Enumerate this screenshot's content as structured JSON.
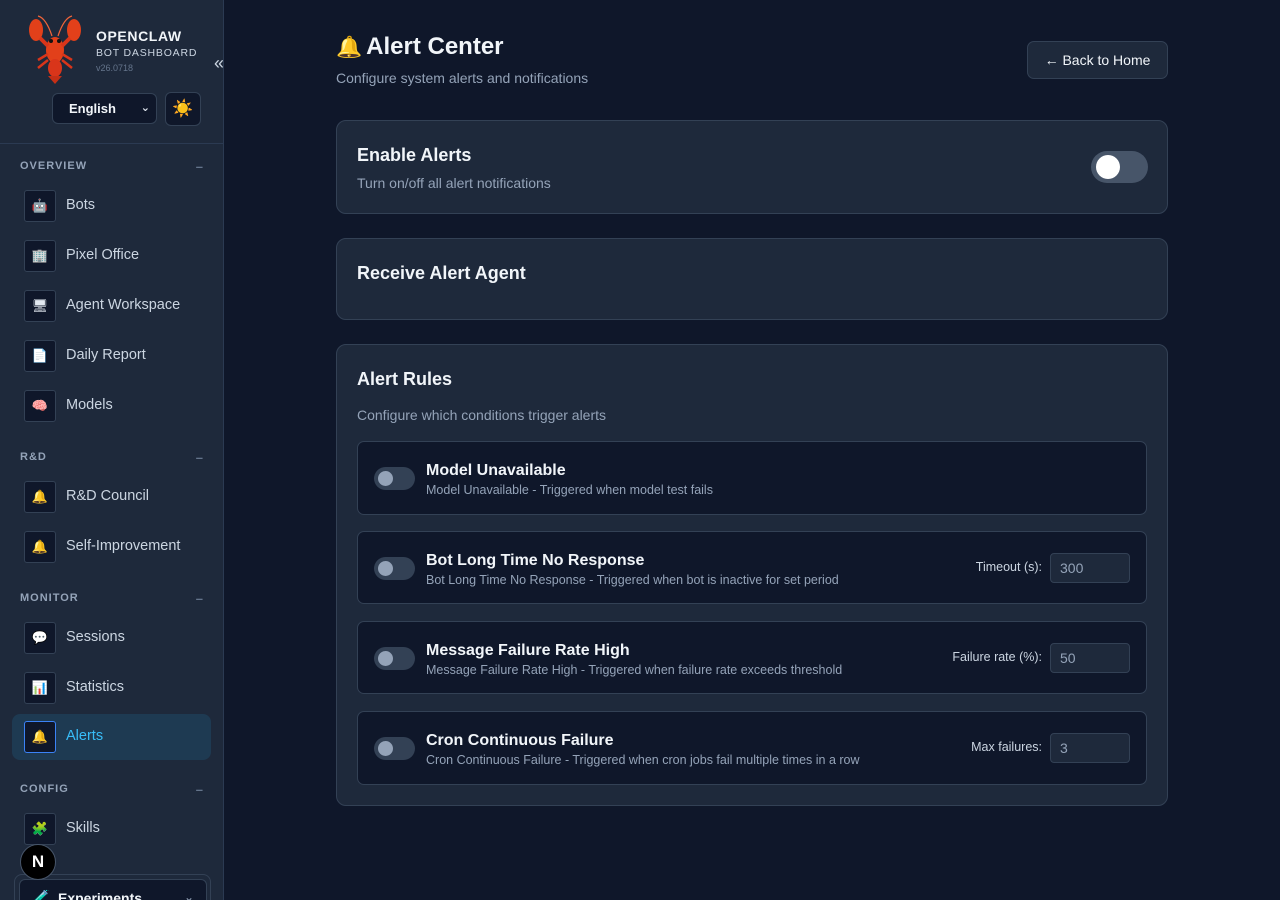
{
  "brand": {
    "name": "OPENCLAW",
    "subtitle": "BOT DASHBOARD",
    "version": "v26.0718",
    "collapse_glyph": "«"
  },
  "language": {
    "selected": "English",
    "chevron": "⌄"
  },
  "theme_toggle": {
    "icon": "sun-icon",
    "glyph": "☀️"
  },
  "sidebar": {
    "sections": [
      {
        "title": "OVERVIEW",
        "collapse": "–"
      },
      {
        "title": "R&D",
        "collapse": "–"
      },
      {
        "title": "MONITOR",
        "collapse": "–"
      },
      {
        "title": "CONFIG",
        "collapse": "–"
      }
    ],
    "items": [
      {
        "label": "Bots",
        "glyph": "🤖",
        "icon": "robot-icon"
      },
      {
        "label": "Pixel Office",
        "glyph": "🏢",
        "icon": "office-icon"
      },
      {
        "label": "Agent Workspace",
        "glyph": "🖥",
        "icon": "workspace-icon"
      },
      {
        "label": "Daily Report",
        "glyph": "📄",
        "icon": "report-icon"
      },
      {
        "label": "Models",
        "glyph": "🧠",
        "icon": "models-icon"
      },
      {
        "label": "R&D Council",
        "glyph": "🔔",
        "icon": "council-icon"
      },
      {
        "label": "Self-Improvement",
        "glyph": "🔔",
        "icon": "improvement-icon"
      },
      {
        "label": "Sessions",
        "glyph": "💬",
        "icon": "sessions-icon"
      },
      {
        "label": "Statistics",
        "glyph": "📊",
        "icon": "statistics-icon"
      },
      {
        "label": "Alerts",
        "glyph": "🔔",
        "icon": "bell-icon"
      },
      {
        "label": "Skills",
        "glyph": "🧩",
        "icon": "skills-icon"
      }
    ],
    "active": "Alerts",
    "n_badge": "N",
    "experiments": {
      "label": "Experiments",
      "glyph": "🧪",
      "chevron": "⌄"
    }
  },
  "header": {
    "title": "Alert Center",
    "title_glyph": "🔔",
    "subtitle": "Configure system alerts and notifications",
    "back_button": "← Back to Home"
  },
  "enable_alerts": {
    "title": "Enable Alerts",
    "description": "Turn on/off all alert notifications",
    "enabled": false
  },
  "receive_agent": {
    "title": "Receive Alert Agent"
  },
  "alert_rules": {
    "title": "Alert Rules",
    "description": "Configure which conditions trigger alerts",
    "rules": [
      {
        "title": "Model Unavailable",
        "description": "Model Unavailable - Triggered when model test fails",
        "enabled": false
      },
      {
        "title": "Bot Long Time No Response",
        "description": "Bot Long Time No Response - Triggered when bot is inactive for set period",
        "enabled": false,
        "param_label": "Timeout (s):",
        "param_value": "300"
      },
      {
        "title": "Message Failure Rate High",
        "description": "Message Failure Rate High - Triggered when failure rate exceeds threshold",
        "enabled": false,
        "param_label": "Failure rate (%):",
        "param_value": "50"
      },
      {
        "title": "Cron Continuous Failure",
        "description": "Cron Continuous Failure - Triggered when cron jobs fail multiple times in a row",
        "enabled": false,
        "param_label": "Max failures:",
        "param_value": "3"
      }
    ]
  }
}
